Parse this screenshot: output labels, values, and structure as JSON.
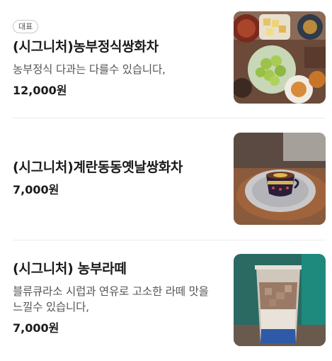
{
  "menu": {
    "items": [
      {
        "badge": "대표",
        "name": "(시그니처)농부정식쌍화차",
        "description": "농부정식 다과는 다를수 있습니다,",
        "price": "12,000원"
      },
      {
        "name": "(시그니처)계란동동옛날쌍화차",
        "price": "7,000원"
      },
      {
        "name": "(시그니처) 농부라떼",
        "description": "블류큐라소 시럽과 연유로 고소한 라떼 맛을 느낄수 있습니다,",
        "price": "7,000원"
      }
    ]
  }
}
